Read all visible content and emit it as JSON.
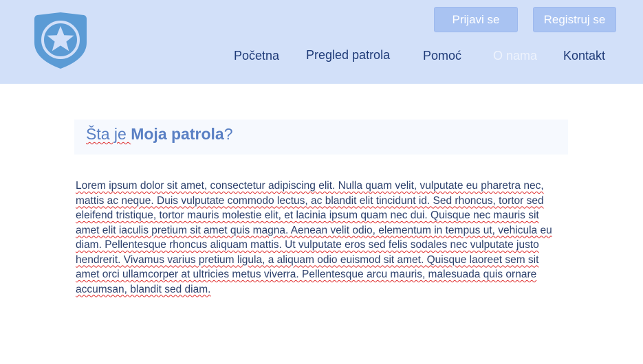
{
  "header": {
    "logo_icon": "police-badge-star-icon",
    "login_label": "Prijavi se",
    "register_label": "Registruj se",
    "nav": [
      {
        "label": "Početna"
      },
      {
        "label": "Pregled patrola"
      },
      {
        "label": "Pomoć"
      },
      {
        "label": "O nama",
        "active": true
      },
      {
        "label": "Kontakt"
      }
    ]
  },
  "main": {
    "title_prefix": "Šta je ",
    "title_brand": "Moja patrola",
    "title_suffix": "?",
    "body": "Lorem ipsum dolor sit amet, consectetur adipiscing elit. Nulla quam velit, vulputate eu pharetra nec, mattis ac neque. Duis vulputate commodo lectus, ac blandit elit tincidunt id. Sed rhoncus, tortor sed eleifend tristique, tortor mauris molestie elit, et lacinia ipsum quam nec dui. Quisque nec mauris sit amet elit iaculis pretium sit amet quis magna. Aenean velit odio, elementum in tempus ut, vehicula eu diam. Pellentesque rhoncus aliquam mattis. Ut vulputate eros sed felis sodales nec vulputate justo hendrerit. Vivamus varius pretium ligula, a aliquam odio euismod sit amet. Quisque laoreet sem sit amet orci ullamcorper at ultricies metus viverra. Pellentesque arcu mauris, malesuada quis ornare accumsan, blandit sed diam."
  },
  "colors": {
    "header_bg": "#d2e0f9",
    "button_bg": "#a9c3f2",
    "nav_text": "#1f3b78",
    "logo": "#5b9bd5"
  }
}
